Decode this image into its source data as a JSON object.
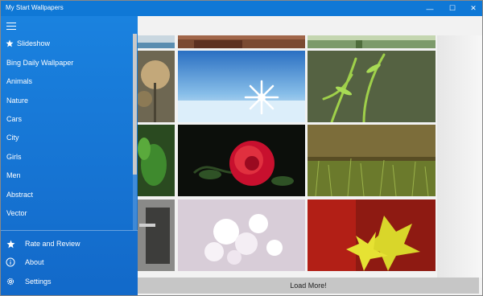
{
  "window": {
    "title": "My Start Wallpapers",
    "controls": {
      "minimize": "—",
      "maximize": "☐",
      "close": "✕"
    }
  },
  "sidebar": {
    "menu_icon": "hamburger-icon",
    "items": [
      {
        "label": "Slideshow",
        "icon": "star-icon"
      },
      {
        "label": "Bing Daily Wallpaper"
      },
      {
        "label": "Animals"
      },
      {
        "label": "Nature"
      },
      {
        "label": "Cars"
      },
      {
        "label": "City"
      },
      {
        "label": "Girls"
      },
      {
        "label": "Men"
      },
      {
        "label": "Abstract"
      },
      {
        "label": "Vector"
      }
    ],
    "footer": [
      {
        "label": "Rate and Review",
        "icon": "star-icon"
      },
      {
        "label": "About",
        "icon": "info-icon"
      },
      {
        "label": "Settings",
        "icon": "gear-icon"
      }
    ]
  },
  "gallery": {
    "load_more": "Load More!"
  },
  "colors": {
    "accent": "#0f78d6",
    "sidebar": "#1673d2",
    "button": "#c6c6c6"
  }
}
